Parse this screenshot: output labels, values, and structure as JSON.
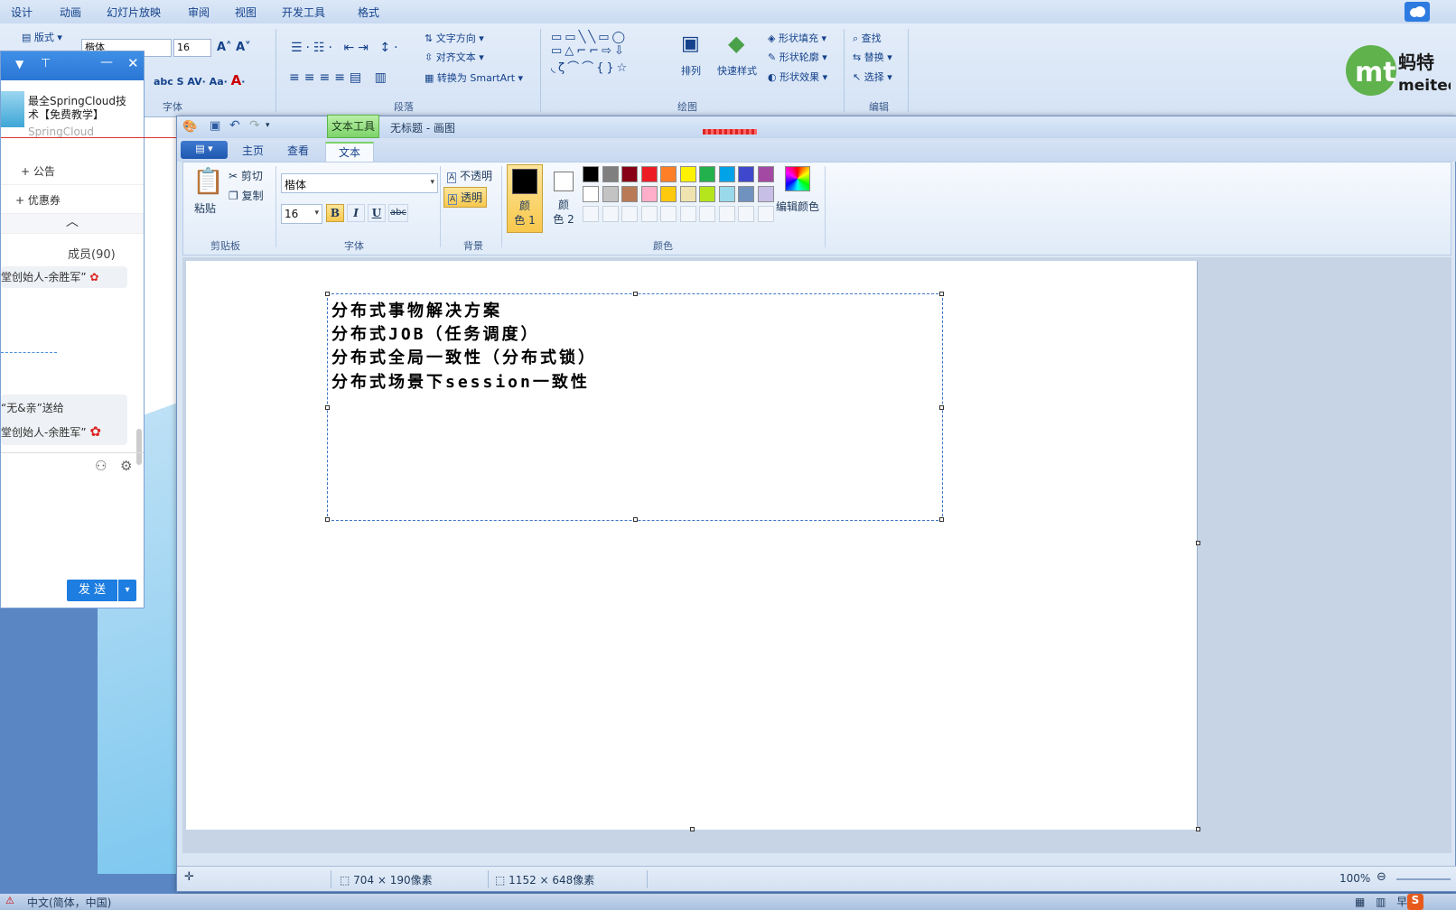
{
  "ppt": {
    "tabs": [
      "设计",
      "动画",
      "幻灯片放映",
      "审阅",
      "视图",
      "开发工具",
      "格式"
    ],
    "layout_btn": "版式",
    "font_name": "楷体",
    "font_size": "16",
    "para_btns": {
      "text_dir": "文字方向",
      "align_text": "对齐文本",
      "smartart": "转换为 SmartArt"
    },
    "draw_btns": {
      "arrange": "排列",
      "quick_styles": "快速样式",
      "shape_fill": "形状填充",
      "shape_outline": "形状轮廓",
      "shape_effects": "形状效果"
    },
    "edit_btns": {
      "find": "查找",
      "replace": "替换",
      "select": "选择"
    },
    "groups": {
      "font": "字体",
      "paragraph": "段落",
      "drawing": "绘图",
      "editing": "编辑"
    },
    "logo": {
      "line1": "蚂特",
      "line2": "meitee"
    }
  },
  "qq": {
    "group_name": "最全SpringCloud技术【免费教学】",
    "group_sub": "SpringCloud",
    "announcement": "公告",
    "coupon": "优惠券",
    "members": "成员(90)",
    "msg1": "堂创始人-余胜军”",
    "msg2a": "“无&亲”送给",
    "msg2b": "堂创始人-余胜军”",
    "send": "发 送"
  },
  "paint": {
    "title": "无标题 - 画图",
    "context_tab": "文本工具",
    "tabs": [
      "主页",
      "查看",
      "文本"
    ],
    "clipboard": {
      "paste": "粘贴",
      "cut": "剪切",
      "copy": "复制",
      "group": "剪贴板"
    },
    "font": {
      "name": "楷体",
      "size": "16",
      "bold": "B",
      "italic": "I",
      "underline": "U",
      "strike": "abc",
      "group": "字体"
    },
    "background": {
      "opaque": "不透明",
      "transparent": "透明",
      "group": "背景"
    },
    "colors": {
      "color1_a": "颜",
      "color1_b": "色 1",
      "color2_a": "颜",
      "color2_b": "色 2",
      "edit": "编辑颜色",
      "group": "颜色",
      "color1": "#000000",
      "color2": "#ffffff",
      "row1": [
        "#000000",
        "#7f7f7f",
        "#880015",
        "#ed1c24",
        "#ff7f27",
        "#fff200",
        "#22b14c",
        "#00a2e8",
        "#3f48cc",
        "#a349a4"
      ],
      "row2": [
        "#ffffff",
        "#c3c3c3",
        "#b97a57",
        "#ffaec9",
        "#ffc90e",
        "#efe4b0",
        "#b5e61d",
        "#99d9ea",
        "#7092be",
        "#c8bfe7"
      ]
    },
    "text_lines": [
      "分布式事物解决方案",
      "分布式JOB（任务调度）",
      "分布式全局一致性（分布式锁）",
      "分布式场景下session一致性"
    ],
    "status": {
      "selection": "704 × 190像素",
      "canvas": "1152 × 648像素",
      "zoom": "100%"
    }
  },
  "taskbar": {
    "ime": "中文(简体，中国)"
  }
}
